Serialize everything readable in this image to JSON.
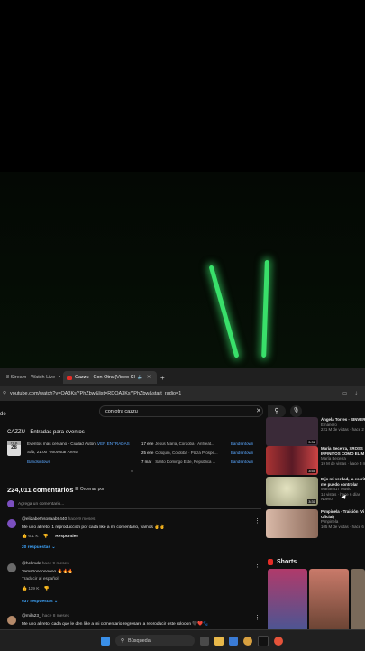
{
  "browser": {
    "tabs": [
      {
        "label": "8 Stream - Watch Live"
      },
      {
        "label": "Cazzu - Con Otra (Video Cl"
      }
    ],
    "new_tab": "+",
    "url": "youtube.com/watch?v=OA3KsYPhZbw&list=RDOA3KsYPhZbw&start_radio=1"
  },
  "search": {
    "value": "con otra cazzu",
    "left_fragment": "de"
  },
  "events": {
    "title": "CAZZU - Entradas para eventos",
    "badge_month": "FEB",
    "badge_day": "28",
    "next_label": "Eventos más cercano - Ciudad Autón…",
    "buy_label": "VER ENTRADAS",
    "time_venue": "Sáb, 21:00 · Movistar Arena",
    "source": "Bandsintown",
    "rows": [
      {
        "date": "17 ene",
        "place": "Jesús María, Córdoba - Anfiteat...",
        "link": "Bandsintown"
      },
      {
        "date": "25 ene",
        "place": "Cosquín, Córdoba · Plaza Próspe...",
        "link": "Bandsintown"
      },
      {
        "date": "7 mar",
        "place": "Santo Domingo Este, República ...",
        "link": "Bandsintown"
      }
    ]
  },
  "comments": {
    "count": "224,011 comentarios",
    "sort": "Ordenar por",
    "add_placeholder": "Agrega un comentario...",
    "items": [
      {
        "author": "@elizabethsosaab9440",
        "ago": "hace 9 meses",
        "text": "Me uno al reto, 1 reproducción por cada like a mi comentario, vamos ✌️✌️",
        "likes": "6.1 K",
        "reply": "Responder",
        "replies": "20 respuestas",
        "avatar": "#7b4fbf"
      },
      {
        "author": "@hcllmde",
        "ago": "hace 9 meses",
        "text": "Temazooooooooo 🔥🔥🔥",
        "translate": "Traducir al español",
        "likes": "119 K",
        "replies": "937 respuestas",
        "avatar": "#6a6a6a"
      },
      {
        "author": "@mila23_",
        "ago": "hace 8 meses",
        "text": "Me uno al reto, cada que le den like a mi comentario regresare a reproducir este rolooon 🖤❤️🐾",
        "avatar": "#b58a6a"
      }
    ]
  },
  "sidebar": {
    "videos": [
      {
        "title": "Ángela Torres - SINVER",
        "channel": "Emanero",
        "views": "221 M de vistas · hace 2 años",
        "duration": "3:36",
        "color": "#3a2a38"
      },
      {
        "title": "María Becerra, XROSS",
        "title2": "INFINITOS COMO EL M",
        "channel": "María Becerra",
        "views": "19 M de vistas · hace 3 me",
        "duration": "3:55",
        "color": "#8b2b3b"
      },
      {
        "title": "Dijo mi verdad, la escrita",
        "title2": "me puedo controlar",
        "channel": "Mariana17 Music",
        "views": "14 vistas · hace 6 días",
        "badge": "Nuevo",
        "duration": "3:31",
        "color": "#b7b69a"
      },
      {
        "title": "Pimpinela - Traición (Vi",
        "title2": "Oficial)",
        "channel": "Pimpinela",
        "views": "105 M de vistas · hace 6 año",
        "duration": "",
        "color": "#c9aa9a"
      }
    ],
    "shorts_label": "Shorts"
  },
  "taskbar": {
    "search_label": "Búsqueda"
  }
}
